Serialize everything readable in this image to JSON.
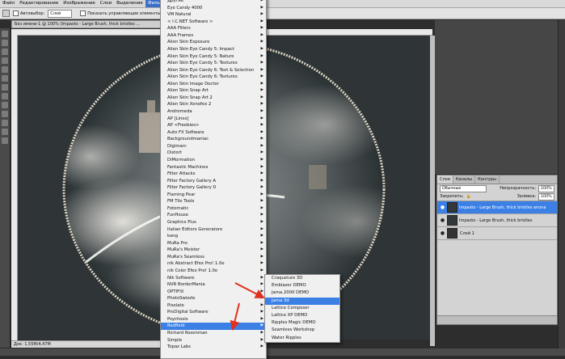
{
  "menubar": {
    "items": [
      "Файл",
      "Редактирование",
      "Изображение",
      "Слои",
      "Выделение",
      "Фильтр"
    ]
  },
  "options": {
    "autoselect_label": "Автовыбор:",
    "autoselect_value": "Слой",
    "show_controls_label": "Показать управляющие элементы"
  },
  "document": {
    "tab_title": "Без имени-1 @ 100% (Impasto - Large Brush, thick bristles ...",
    "status_text": "Док: 1,55M/4,47M"
  },
  "filter_menu": {
    "items": [
      {
        "label": "Другие",
        "submenu": true
      },
      {
        "label": "Eye Candy 4000",
        "submenu": true
      },
      {
        "label": "VM Natural",
        "submenu": true
      },
      {
        "label": "< I.C.NET Software >",
        "submenu": true
      },
      {
        "label": "AAA Filters",
        "submenu": true
      },
      {
        "label": "AAA Frames",
        "submenu": true
      },
      {
        "label": "Alien Skin Exposure",
        "submenu": true
      },
      {
        "label": "Alien Skin Eye Candy 5: Impact",
        "submenu": true
      },
      {
        "label": "Alien Skin Eye Candy 5: Nature",
        "submenu": true
      },
      {
        "label": "Alien Skin Eye Candy 5: Textures",
        "submenu": true
      },
      {
        "label": "Alien Skin Eye Candy 6: Text & Selection",
        "submenu": true
      },
      {
        "label": "Alien Skin Eye Candy 6: Textures",
        "submenu": true
      },
      {
        "label": "Alien Skin Image Doctor",
        "submenu": true
      },
      {
        "label": "Alien Skin Snap Art",
        "submenu": true
      },
      {
        "label": "Alien Skin Snap Art 2",
        "submenu": true
      },
      {
        "label": "Alien Skin Xenofex 2",
        "submenu": true
      },
      {
        "label": "Andromeda",
        "submenu": true
      },
      {
        "label": "AP [Lines]",
        "submenu": true
      },
      {
        "label": "AP <Freebies>",
        "submenu": true
      },
      {
        "label": "Auto FX Software",
        "submenu": true
      },
      {
        "label": "Backgroundmaniac",
        "submenu": true
      },
      {
        "label": "Digimarc",
        "submenu": true
      },
      {
        "label": "Distort",
        "submenu": true
      },
      {
        "label": "DiMormation",
        "submenu": true
      },
      {
        "label": "Fantastic Machines",
        "submenu": true
      },
      {
        "label": "Filter Attacks",
        "submenu": true
      },
      {
        "label": "Filter Factory Gallery A",
        "submenu": true
      },
      {
        "label": "Filter Factory Gallery D",
        "submenu": true
      },
      {
        "label": "Flaming Pear",
        "submenu": true
      },
      {
        "label": "FM Tile Tools",
        "submenu": true
      },
      {
        "label": "Fotomatic",
        "submenu": true
      },
      {
        "label": "FunHouse",
        "submenu": true
      },
      {
        "label": "Graphics Plus",
        "submenu": true
      },
      {
        "label": "Italian Editors Generatore",
        "submenu": true
      },
      {
        "label": "kang",
        "submenu": true
      },
      {
        "label": "MuRa Pro",
        "submenu": true
      },
      {
        "label": "MuRa's Meister",
        "submenu": true
      },
      {
        "label": "MuRa's Seamless",
        "submenu": true
      },
      {
        "label": "nik Abstract Efex Pro! 1.0e",
        "submenu": true
      },
      {
        "label": "nik Color Efex Pro! 1.0e",
        "submenu": true
      },
      {
        "label": "Nik Software",
        "submenu": true
      },
      {
        "label": "NVR BorderMania",
        "submenu": true
      },
      {
        "label": "OPTIFIX",
        "submenu": true
      },
      {
        "label": "PhotoSwizzle",
        "submenu": true
      },
      {
        "label": "Pixelate",
        "submenu": true
      },
      {
        "label": "ProDigital Software",
        "submenu": true
      },
      {
        "label": "Psychosis",
        "submenu": true
      },
      {
        "label": "Redfield",
        "submenu": true,
        "highlighted": true
      },
      {
        "label": "Richard Rosenman",
        "submenu": true
      },
      {
        "label": "Simple",
        "submenu": true
      },
      {
        "label": "Topaz Labs",
        "submenu": true
      }
    ]
  },
  "redfield_submenu": {
    "items": [
      {
        "label": "Craquelure 3D"
      },
      {
        "label": "Emblazer DEMO"
      },
      {
        "label": "Jama 2000 DEMO"
      },
      {
        "label": "Jama 3d",
        "highlighted": true
      },
      {
        "label": "Lattice Composer"
      },
      {
        "label": "Lattice XP DEMO"
      },
      {
        "label": "Ripples Magic DEMO"
      },
      {
        "label": "Seamless Workshop"
      },
      {
        "label": "Water Ripples"
      }
    ]
  },
  "layers_panel": {
    "tabs": [
      "Слои",
      "Каналы",
      "Контуры"
    ],
    "blend_mode": "Обычные",
    "opacity_label": "Непрозрачность:",
    "opacity_value": "100%",
    "lock_label": "Закрепить:",
    "fill_label": "Заливка:",
    "fill_value": "100%",
    "layers": [
      {
        "name": "Impasto - Large Brush, thick bristles wrona",
        "selected": true
      },
      {
        "name": "Impasto - Large Brush, thick bristles",
        "selected": false
      },
      {
        "name": "Слой 1",
        "selected": false
      }
    ]
  },
  "colors": {
    "highlight": "#3c80e6",
    "arrow": "#e0301e",
    "canvas_bg": "#2f3437"
  }
}
